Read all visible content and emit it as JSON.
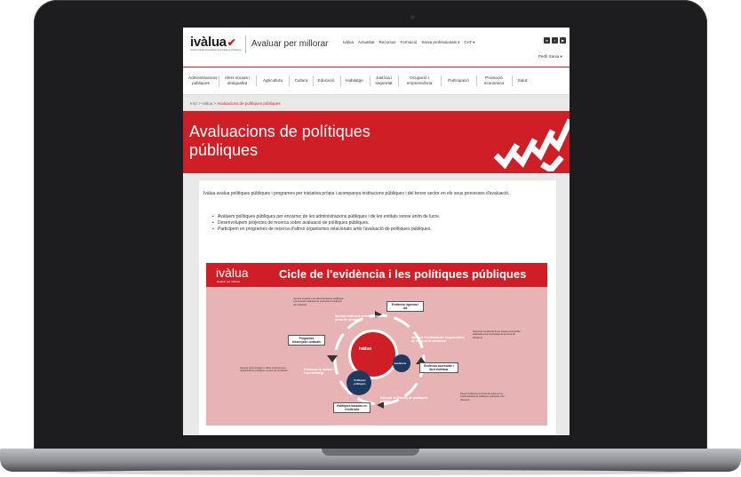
{
  "site": {
    "logo_text": "ivàlua",
    "logo_check": "✔",
    "logo_subtitle": "Institut Català d'Avaluació de Polítiques Públiques",
    "tagline": "Avaluar per millorar",
    "top_links": [
      "Ivàlua",
      "Actualitat",
      "Recursos",
      "Formació",
      "Xarxa professionals ▾",
      "CAT ▾"
    ],
    "socials": [
      "in",
      "t",
      "▶"
    ],
    "profile": "Perfil Xarxa ▾"
  },
  "nav": {
    "items": [
      "Administracions públiques",
      "Afers socials i desigualtat",
      "Agricultura",
      "Cultura",
      "Educació",
      "Habitatge",
      "Justícia i seguretat",
      "Ocupació i emprenedoria",
      "Participació",
      "Promoció econòmica",
      "Salut"
    ]
  },
  "breadcrumb": {
    "home": "Inici",
    "sep1": ">",
    "section": "Ivàlua",
    "sep2": ">",
    "current": "Avaluacions de polítiques públiques"
  },
  "banner": {
    "title": "Avaluacions de polítiques públiques"
  },
  "content": {
    "intro": "Ivàlua avalua polítiques públiques i programes per iniciativa pròpia i acompanya institucions públiques i del tercer sector en els seus processos d'avaluació.",
    "bullets": [
      "Avaluem polítiques públiques per encàrrec de les administracions públiques i de les entitats sense ànim de lucre.",
      "Desenvolupem projectes de recerca sobre avaluació de polítiques públiques.",
      "Participem en programes de recerca d'altres organismes relacionats amb l'avaluació de polítiques públiques."
    ]
  },
  "infographic": {
    "logo": "ivàlua",
    "logo_sub": "Avaluar per millorar",
    "title": "Cicle de l'evidència i les polítiques públiques",
    "center": "ivàlua",
    "evidencia": "Evidència",
    "politiques": "Polítiques públiques",
    "box_top": "Evidència rigorosa i útil",
    "box_right": "Evidència accessible i fàcil d'utilitzar",
    "box_left": "Programes dissenyats i avaluats",
    "box_bottom": "Polítiques basades en l'evidència",
    "step_top": "Aportar evidència rellevant per a la presa de decisions",
    "step_right": "Apropar l'evidència als responsables de la presa de decisions",
    "step_bottom": "Informar el disseny de polítiques públiques",
    "step_left": "Promoure la millora i l'aprenentatge",
    "note_top_left": "Generar impacte a les administracions públiques i a la societat mitjançant la producció d'evidència útil i rellevant.",
    "note_right": "Presentar l'evidència d'una manera accessible i adaptada a les necessitats de la presa de decisions.",
    "note_left": "Generar aprenentatge i millora continua a les organitzacions públiques a partir de l'evidència.",
    "note_bottom_right": "Posar l'evidència al servei del disseny i la implementació de polítiques públiques més efectives."
  },
  "colors": {
    "brand_red": "#cf1e26",
    "infographic_pink": "#e7b3b5",
    "navy": "#1e3a5f"
  }
}
